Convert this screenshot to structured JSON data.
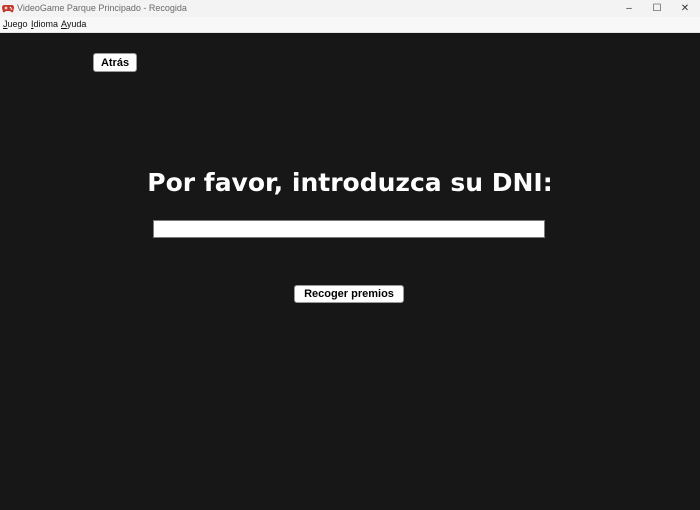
{
  "window": {
    "title": "VideoGame Parque Principado - Recogida",
    "icon": "gamepad-icon",
    "controls": {
      "minimize": "–",
      "maximize": "☐",
      "close": "✕"
    }
  },
  "menu": {
    "items": [
      {
        "mnemonic": "J",
        "rest": "uego"
      },
      {
        "mnemonic": "I",
        "rest": "dioma"
      },
      {
        "mnemonic": "A",
        "rest": "yuda"
      }
    ]
  },
  "content": {
    "back_label": "Atrás",
    "prompt": "Por favor, introduzca su DNI:",
    "dni_value": "",
    "collect_label": "Recoger premios"
  },
  "colors": {
    "background": "#181718",
    "titlebar": "#f3f3f3",
    "prompt_text": "#ffffff"
  }
}
